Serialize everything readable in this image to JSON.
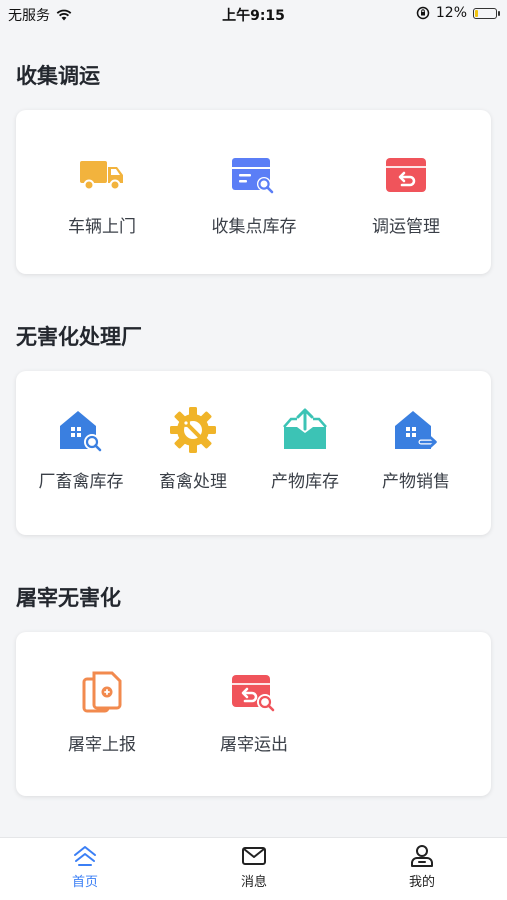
{
  "status_bar": {
    "carrier": "无服务",
    "time": "上午9:15",
    "battery": "12%"
  },
  "sections": [
    {
      "title": "收集调运",
      "items": [
        {
          "label": "车辆上门",
          "icon": "truck-icon"
        },
        {
          "label": "收集点库存",
          "icon": "inventory-search-icon"
        },
        {
          "label": "调运管理",
          "icon": "box-return-icon"
        }
      ]
    },
    {
      "title": "无害化处理厂",
      "items": [
        {
          "label": "厂畜禽库存",
          "icon": "warehouse-search-icon"
        },
        {
          "label": "畜禽处理",
          "icon": "gear-wrench-icon"
        },
        {
          "label": "产物库存",
          "icon": "box-upload-icon"
        },
        {
          "label": "产物销售",
          "icon": "warehouse-export-icon"
        }
      ]
    },
    {
      "title": "屠宰无害化",
      "items": [
        {
          "label": "屠宰上报",
          "icon": "document-report-icon"
        },
        {
          "label": "屠宰运出",
          "icon": "box-return-search-icon"
        }
      ]
    }
  ],
  "tabbar": [
    {
      "label": "首页",
      "icon": "home-icon",
      "active": true
    },
    {
      "label": "消息",
      "icon": "mail-icon",
      "active": false
    },
    {
      "label": "我的",
      "icon": "user-icon",
      "active": false
    }
  ],
  "colors": {
    "accent": "#3b7ff5",
    "truck": "#f2b33d",
    "blue": "#5b7ef6",
    "red": "#f0545b",
    "teal": "#3cc3b5",
    "orange": "#f28a4e",
    "gear": "#f0b429"
  }
}
